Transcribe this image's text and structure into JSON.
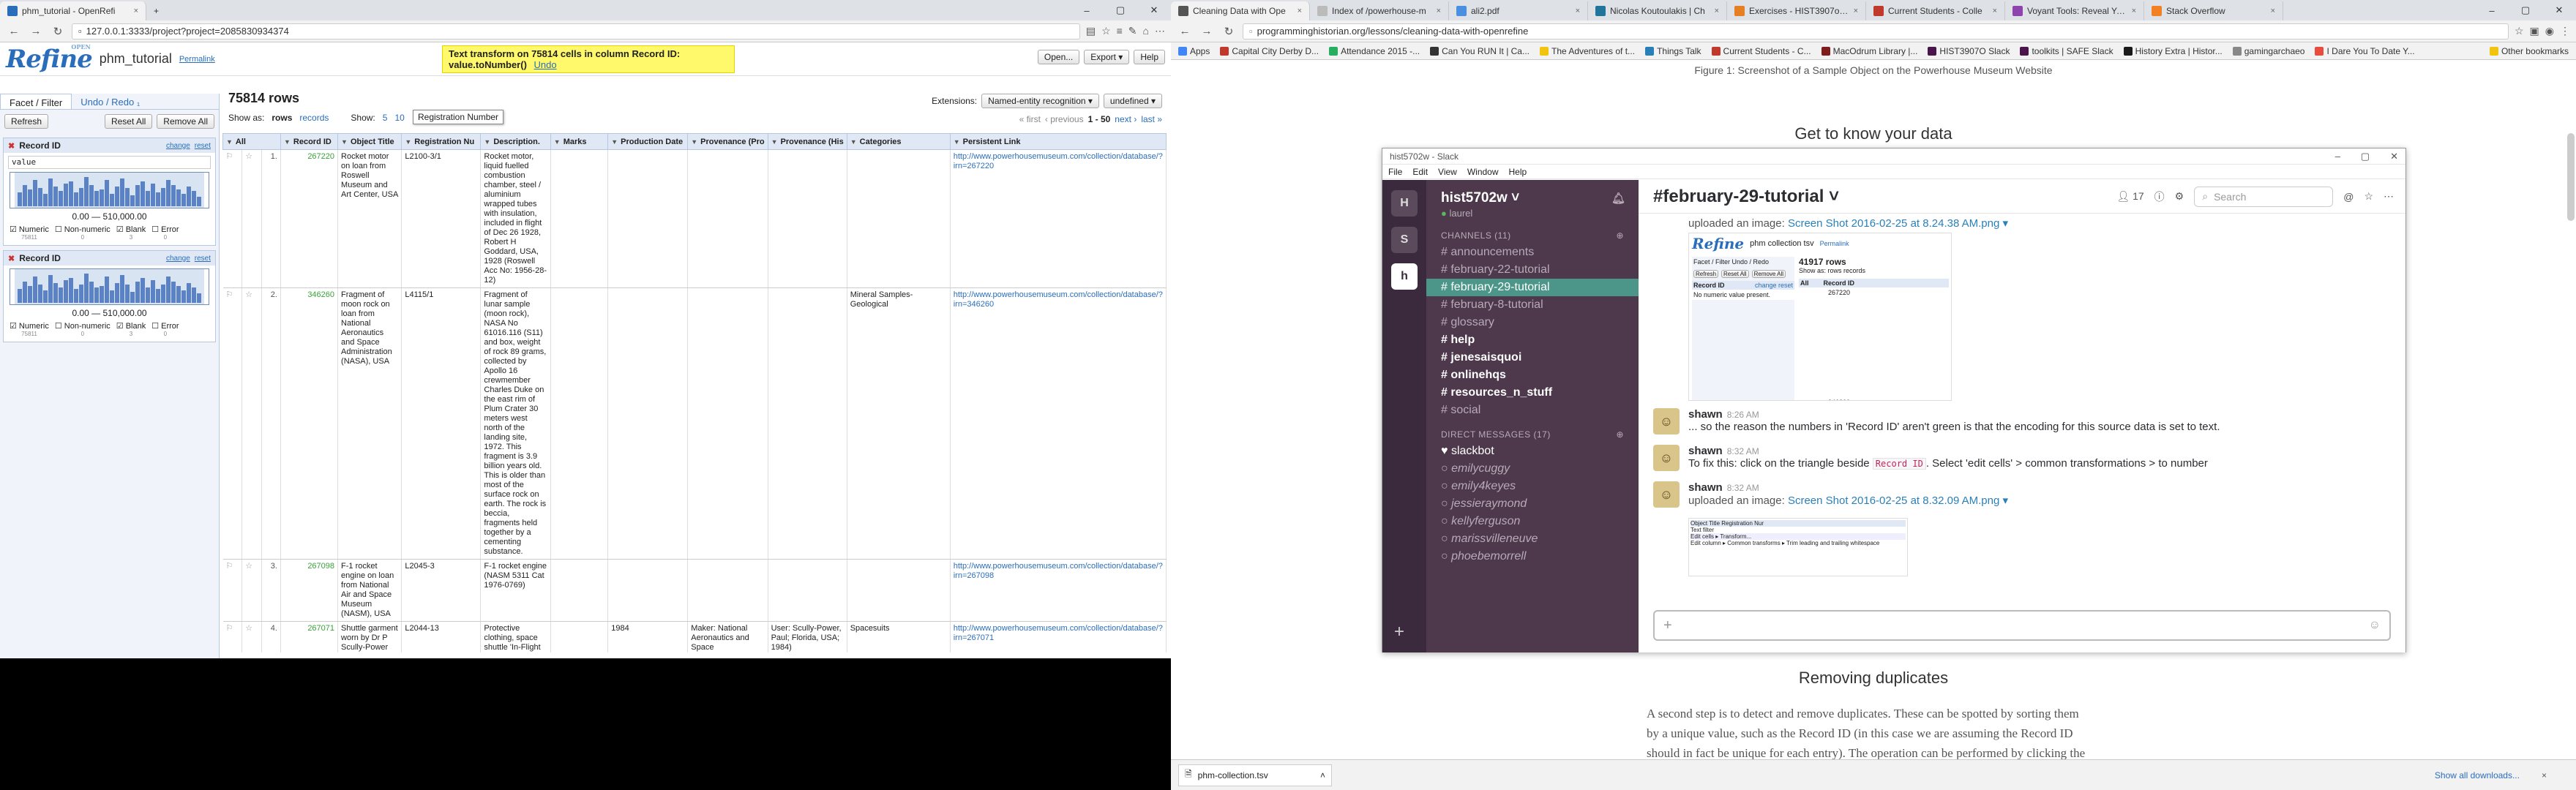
{
  "left_browser": {
    "tab": {
      "title": "phm_tutorial - OpenRefi",
      "close": "×"
    },
    "new_tab": "+",
    "window_controls": [
      "–",
      "▢",
      "✕"
    ],
    "url": "127.0.0.1:3333/project?project=2085830934374",
    "refine": {
      "logo": "Refine",
      "logo_small": "OPEN",
      "project_name": "phm_tutorial",
      "permalink": "Permalink",
      "notice_text": "Text transform on 75814 cells in column Record ID: value.toNumber()",
      "notice_undo": "Undo",
      "actions": [
        "Open...",
        "Export ▾",
        "Help"
      ],
      "left_tabs": [
        "Facet / Filter",
        "Undo / Redo ₁"
      ],
      "refresh": "Refresh",
      "reset_all": "Reset All",
      "remove_all": "Remove All",
      "facets": [
        {
          "title": "Record ID",
          "change": "change",
          "reset": "reset",
          "expression": "value",
          "range": "0.00 — 510,000.00",
          "checks": [
            {
              "label": "Numeric",
              "count": "75811"
            },
            {
              "label": "Non-numeric",
              "count": "0"
            },
            {
              "label": "Blank",
              "count": "3"
            },
            {
              "label": "Error",
              "count": "0"
            }
          ]
        },
        {
          "title": "Record ID",
          "change": "change",
          "reset": "reset",
          "expression": "",
          "range": "0.00 — 510,000.00",
          "checks": [
            {
              "label": "Numeric",
              "count": "75811"
            },
            {
              "label": "Non-numeric",
              "count": "0"
            },
            {
              "label": "Blank",
              "count": "3"
            },
            {
              "label": "Error",
              "count": "0"
            }
          ]
        }
      ],
      "histogram_levels": [
        0.45,
        0.7,
        0.55,
        0.85,
        0.6,
        0.4,
        0.9,
        0.65,
        0.5,
        0.75,
        0.8,
        0.45,
        0.6,
        0.95,
        0.7,
        0.5,
        0.55,
        0.85,
        0.4,
        0.65,
        0.9,
        0.6,
        0.35,
        0.7,
        0.8,
        0.5,
        0.75,
        0.45,
        0.6,
        0.85,
        0.7,
        0.55,
        0.4,
        0.65,
        0.5,
        0.3
      ],
      "row_count": "75814 rows",
      "show_as": "Show as:",
      "show_rows": "rows",
      "show_records": "records",
      "show": "Show:",
      "show_options": [
        "5",
        "10"
      ],
      "tooltip": "Registration Number",
      "extensions_label": "Extensions:",
      "extensions_btn": "Named-entity recognition ▾",
      "undefined_btn": "undefined ▾",
      "pager_first": "« first",
      "pager_prev": "‹ previous",
      "pager_range": "1 - 50",
      "pager_next": "next ›",
      "pager_last": "last »",
      "columns": [
        "All",
        "Record ID",
        "Object Title",
        "Registration Nu",
        "Description.",
        "Marks",
        "Production Date",
        "Provenance (Pro",
        "Provenance (His",
        "Categories",
        "Persistent Link"
      ],
      "rows": [
        {
          "n": "1.",
          "id": "267220",
          "title": "Rocket motor on loan from Roswell Museum and Art Center, USA",
          "reg": "L2100-3/1",
          "desc": "Rocket motor, liquid fuelled combustion chamber, steel / aluminium wrapped tubes with insulation, included in flight of Dec 26 1928, Robert H Goddard, USA, 1928 (Roswell Acc No: 1956-28-12)",
          "marks": "",
          "date": "",
          "prov1": "",
          "prov2": "",
          "cat": "",
          "link": "http://www.powerhousemuseum.com/collection/database/?irn=267220"
        },
        {
          "n": "2.",
          "id": "346260",
          "title": "Fragment of moon rock on loan from National Aeronautics and Space Administration (NASA), USA",
          "reg": "L4115/1",
          "desc": "Fragment of lunar sample (moon rock), NASA No 61016.116 (S11) and box, weight of rock 89 grams, collected by Apollo 16 crewmember Charles Duke on the east rim of Plum Crater 30 meters west north of the landing site, 1972. This fragment is 3.9 billion years old. This is older than most of the surface rock on earth. The rock is beccia, fragments held together by a cementing substance.",
          "marks": "",
          "date": "",
          "prov1": "",
          "prov2": "",
          "cat": "Mineral Samples-Geological",
          "link": "http://www.powerhousemuseum.com/collection/database/?irn=346260"
        },
        {
          "n": "3.",
          "id": "267098",
          "title": "F-1 rocket engine on loan from National Air and Space Museum (NASM), USA",
          "reg": "L2045-3",
          "desc": "F-1 rocket engine (NASM 5311 Cat 1976-0769)",
          "marks": "",
          "date": "",
          "prov1": "",
          "prov2": "",
          "cat": "",
          "link": "http://www.powerhousemuseum.com/collection/database/?irn=267098"
        },
        {
          "n": "4.",
          "id": "267071",
          "title": "Shuttle garment worn by Dr P Scully-Power on loan from",
          "reg": "L2044-13",
          "desc": "Protective clothing, space shuttle 'In-Flight Coverall",
          "marks": "",
          "date": "1984",
          "prov1": "Maker: National Aeronautics and Space Administration",
          "prov2": "User: Scully-Power, Paul; Florida, USA; 1984)",
          "cat": "Spacesuits",
          "link": "http://www.powerhousemuseum.com/collection/database/?irn=267071"
        }
      ]
    }
  },
  "right_browser": {
    "tabs": [
      {
        "title": "Cleaning Data with Ope",
        "color": "#555",
        "active": true
      },
      {
        "title": "Index of /powerhouse-m",
        "color": "#bbb",
        "active": false
      },
      {
        "title": "ali2.pdf",
        "color": "#4a8fe0",
        "active": false
      },
      {
        "title": "Nicolas Koutoulakis | Ch",
        "color": "#21759b",
        "active": false
      },
      {
        "title": "Exercises - HIST3907o Cr",
        "color": "#e67e22",
        "active": false
      },
      {
        "title": "Current Students - Colle",
        "color": "#c0392b",
        "active": false
      },
      {
        "title": "Voyant Tools: Reveal Your",
        "color": "#8e44ad",
        "active": false
      },
      {
        "title": "Stack Overflow",
        "color": "#f48024",
        "active": false
      }
    ],
    "url": "programminghistorian.org/lessons/cleaning-data-with-openrefine",
    "bookmarks": [
      {
        "label": "Apps",
        "color": "#4285f4"
      },
      {
        "label": "Capital City Derby D...",
        "color": "#c0392b"
      },
      {
        "label": "Attendance 2015 -...",
        "color": "#27ae60"
      },
      {
        "label": "Can You RUN It | Ca...",
        "color": "#333"
      },
      {
        "label": "The Adventures of t...",
        "color": "#f1c40f"
      },
      {
        "label": "Things Talk",
        "color": "#2980b9"
      },
      {
        "label": "Current Students - C...",
        "color": "#c0392b"
      },
      {
        "label": "MacOdrum Library |...",
        "color": "#7f1d1d"
      },
      {
        "label": "HIST3907O Slack",
        "color": "#4a154b"
      },
      {
        "label": "toolkits | SAFE Slack",
        "color": "#4a154b"
      },
      {
        "label": "History Extra | Histor...",
        "color": "#1a1a1a"
      },
      {
        "label": "gamingarchaeo",
        "color": "#888"
      },
      {
        "label": "I Dare You To Date Y...",
        "color": "#e74c3c"
      },
      {
        "label": "Other bookmarks",
        "color": "#f1c40f"
      }
    ],
    "caption": "Figure 1: Screenshot of a Sample Object on the Powerhouse Museum Website",
    "heading1": "Get to know your data",
    "heading2": "Removing duplicates",
    "paragraph": "A second step is to detect and remove duplicates. These can be spotted by sorting them by a unique value, such as the Record ID (in this case we are assuming the Record ID should in fact be unique for each entry). The operation can be performed by clicking the triangle left of Record ID, then choosing 'Sort'... and selecting the 'numbers' bullet.",
    "slack": {
      "window_title": "hist5702w - Slack",
      "window_controls": [
        "–",
        "▢",
        "✕"
      ],
      "menu": [
        "File",
        "Edit",
        "View",
        "Window",
        "Help"
      ],
      "teams": [
        "H",
        "S",
        "h"
      ],
      "add_team": "+",
      "workspace": "hist5702w",
      "user": "laurel",
      "channels_header": "CHANNELS (11)",
      "channels": [
        {
          "name": "# announcements",
          "style": ""
        },
        {
          "name": "# february-22-tutorial",
          "style": ""
        },
        {
          "name": "# february-29-tutorial",
          "style": "sel"
        },
        {
          "name": "# february-8-tutorial",
          "style": ""
        },
        {
          "name": "# glossary",
          "style": ""
        },
        {
          "name": "# help",
          "style": "bold"
        },
        {
          "name": "# jenesaisquoi",
          "style": "bold"
        },
        {
          "name": "# onlinehqs",
          "style": "bold"
        },
        {
          "name": "# resources_n_stuff",
          "style": "bold"
        },
        {
          "name": "# social",
          "style": ""
        }
      ],
      "dm_header": "DIRECT MESSAGES (17)",
      "dms": [
        {
          "name": "♥ slackbot",
          "on": true
        },
        {
          "name": "○ emilycuggy",
          "on": false
        },
        {
          "name": "○ emily4keyes",
          "on": false
        },
        {
          "name": "○ jessieraymond",
          "on": false
        },
        {
          "name": "○ kellyferguson",
          "on": false
        },
        {
          "name": "○ marissvilleneuve",
          "on": false
        },
        {
          "name": "○ phoebemorrell",
          "on": false
        }
      ],
      "channel_title": "#february-29-tutorial ˅",
      "members": "17",
      "search_placeholder": "Search",
      "messages": [
        {
          "who": "",
          "time": "",
          "text": "uploaded an image:",
          "link": "Screen Shot 2016-02-25 at 8.24.38 AM.png ▾"
        },
        {
          "who": "shawn",
          "time": "8:26 AM",
          "text": "... so the reason the numbers in 'Record ID' aren't green is that the encoding for this source data is set to text.",
          "link": ""
        },
        {
          "who": "shawn",
          "time": "8:32 AM",
          "text_a": "To fix this: click on the triangle beside",
          "code": "Record ID",
          "text_b": ". Select 'edit cells' > common transformations > to number",
          "link": ""
        },
        {
          "who": "shawn",
          "time": "8:32 AM",
          "text": "uploaded an image:",
          "link": "Screen Shot 2016-02-25 at 8.32.09 AM.png ▾"
        }
      ],
      "thumb1": {
        "project": "phm collection tsv",
        "permalink": "Permalink",
        "tabs": "Facet / Filter   Undo / Redo",
        "refresh": "Refresh",
        "reset": "Reset All",
        "remove": "Remove All",
        "rows": "41917 rows",
        "show_as": "Show as: rows records",
        "facet": "Record ID",
        "facet_change": "change reset",
        "facet_msg": "No numeric value present.",
        "col_all": "All",
        "col_id": "Record ID",
        "r1": "267220",
        "r2": "346260"
      },
      "thumb2": {
        "rows": [
          "Object Title  Registration Nur",
          "Text filter",
          "Edit cells ▸  Transform...",
          "Edit column ▸  Common transforms ▸  Trim leading and trailing whitespace"
        ]
      }
    },
    "download": {
      "file": "phm-collection.tsv",
      "show_all": "Show all downloads...",
      "close": "×"
    }
  }
}
